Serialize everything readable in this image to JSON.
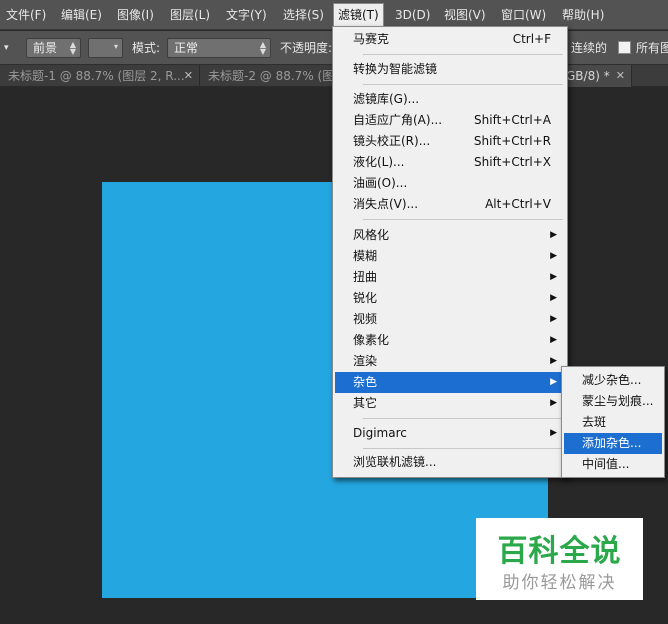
{
  "menubar": {
    "items": [
      "文件(F)",
      "编辑(E)",
      "图像(I)",
      "图层(L)",
      "文字(Y)",
      "选择(S)",
      "滤镜(T)",
      "3D(D)",
      "视图(V)",
      "窗口(W)",
      "帮助(H)"
    ],
    "active": "滤镜(T)"
  },
  "options": {
    "fill_source": "前景",
    "mode_label": "模式:",
    "mode_value": "正常",
    "opacity_label": "不透明度:",
    "contiguous_label": "连续的",
    "all_layers_label": "所有图"
  },
  "tabs": [
    {
      "label": "未标题-1 @ 88.7% (图层 2, R..."
    },
    {
      "label": "未标题-2 @ 88.7% (图"
    },
    {
      "label": "GB/8) *"
    }
  ],
  "filter_menu": {
    "items": [
      {
        "label": "马赛克",
        "shortcut": "Ctrl+F"
      },
      {
        "label": "转换为智能滤镜"
      },
      {
        "label": "滤镜库(G)..."
      },
      {
        "label": "自适应广角(A)...",
        "shortcut": "Shift+Ctrl+A"
      },
      {
        "label": "镜头校正(R)...",
        "shortcut": "Shift+Ctrl+R"
      },
      {
        "label": "液化(L)...",
        "shortcut": "Shift+Ctrl+X"
      },
      {
        "label": "油画(O)..."
      },
      {
        "label": "消失点(V)...",
        "shortcut": "Alt+Ctrl+V"
      },
      {
        "label": "风格化"
      },
      {
        "label": "模糊"
      },
      {
        "label": "扭曲"
      },
      {
        "label": "锐化"
      },
      {
        "label": "视频"
      },
      {
        "label": "像素化"
      },
      {
        "label": "渲染"
      },
      {
        "label": "杂色"
      },
      {
        "label": "其它"
      },
      {
        "label": "Digimarc"
      },
      {
        "label": "浏览联机滤镜..."
      }
    ],
    "highlighted": "杂色"
  },
  "noise_submenu": {
    "items": [
      {
        "label": "减少杂色..."
      },
      {
        "label": "蒙尘与划痕..."
      },
      {
        "label": "去斑"
      },
      {
        "label": "添加杂色..."
      },
      {
        "label": "中间值..."
      }
    ],
    "highlighted": "添加杂色..."
  },
  "canvas": {
    "fill_color": "#24a7e1"
  },
  "watermark": {
    "title": "百科全说",
    "subtitle": "助你轻松解决"
  },
  "colors": {
    "highlight": "#1c6fd0",
    "ui_dark": "#535353",
    "watermark_green": "#2aa84a"
  }
}
